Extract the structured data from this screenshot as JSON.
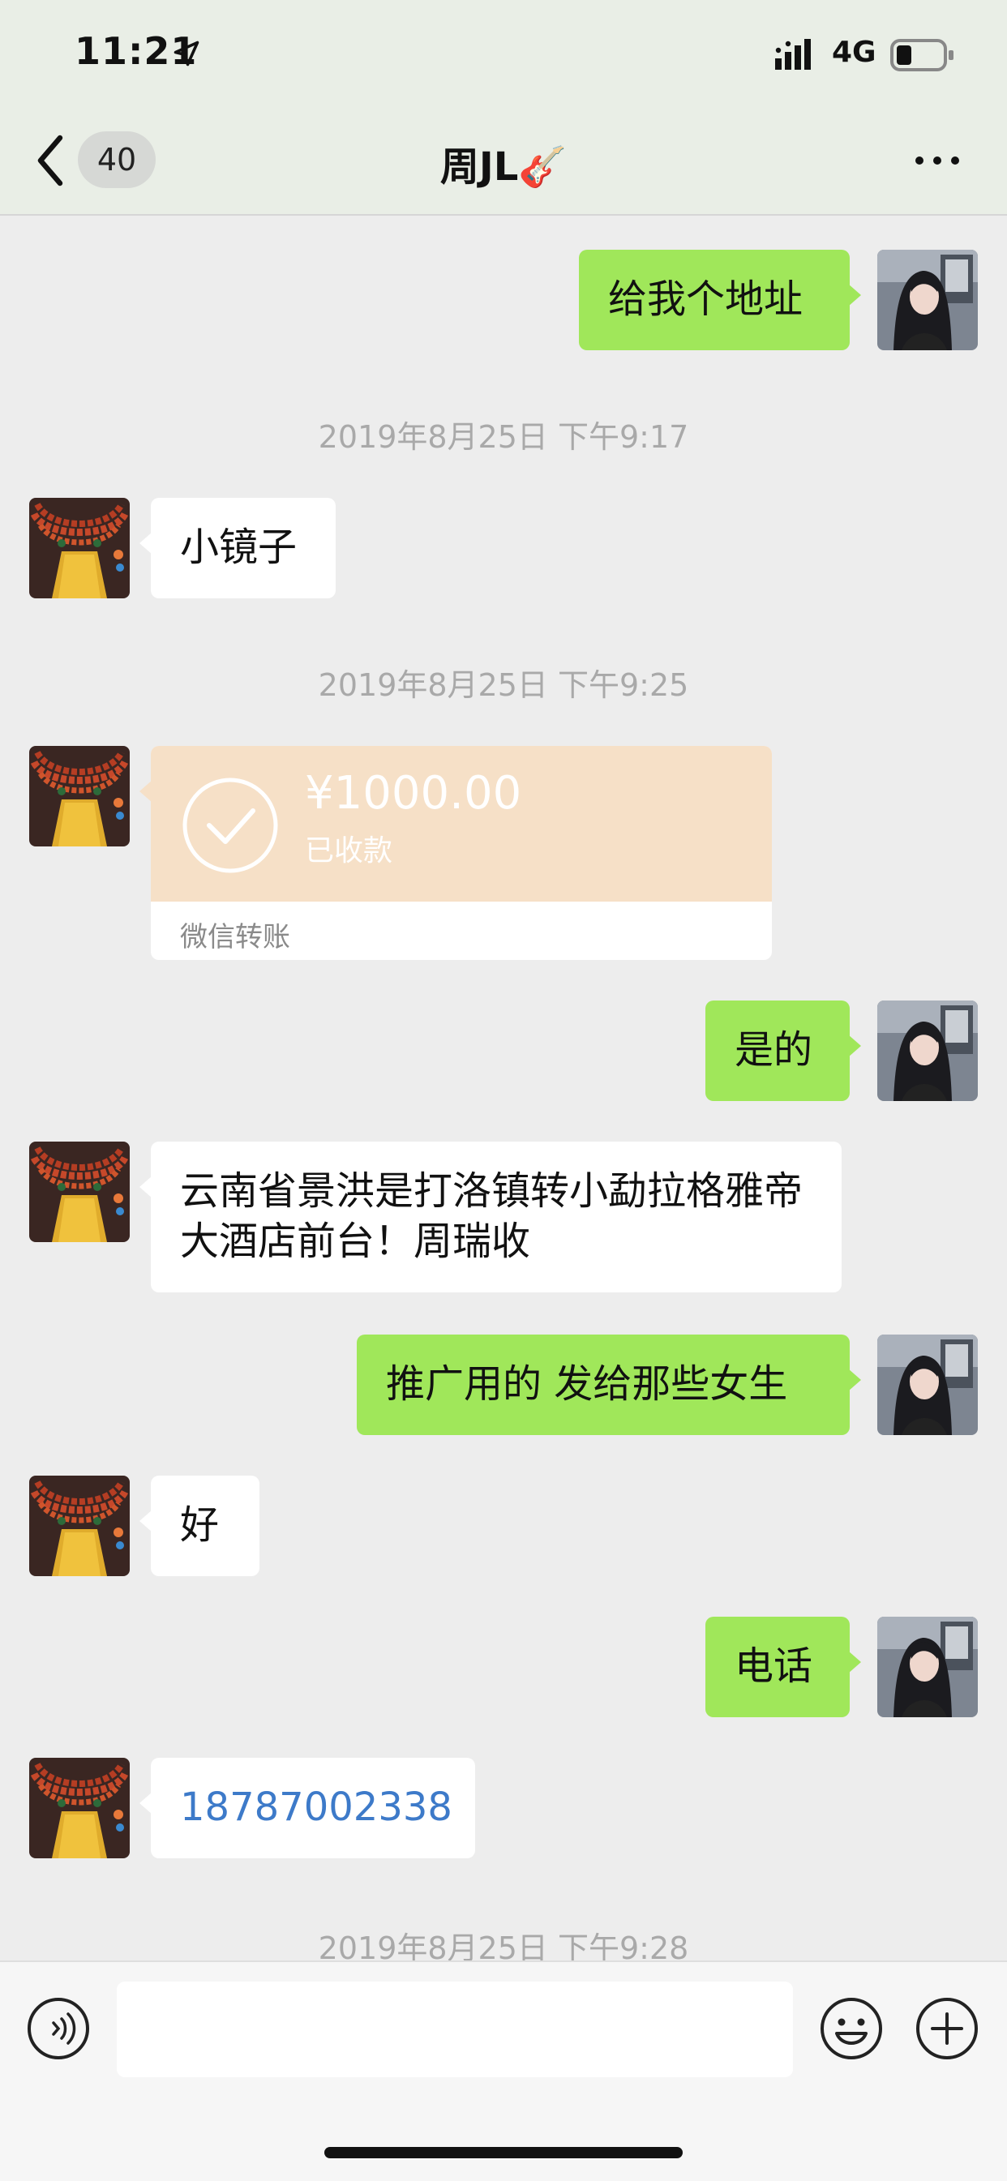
{
  "status_bar": {
    "time": "11:21",
    "network": "4G"
  },
  "nav": {
    "badge_count": "40",
    "title": "周JL🎸"
  },
  "messages": {
    "m1": "给我个地址",
    "ts1": "2019年8月25日 下午9:17",
    "m2": "小镜子",
    "ts2": "2019年8月25日 下午9:25",
    "transfer": {
      "amount": "¥1000.00",
      "status": "已收款",
      "label": "微信转账"
    },
    "m3": "是的",
    "m4": "云南省景洪是打洛镇转小勐拉格雅帝大酒店前台！周瑞收",
    "m5": "推广用的 发给那些女生",
    "m6": "好",
    "m7": "电话",
    "m8": "18787002338",
    "ts3": "2019年8月25日 下午9:28"
  },
  "colors": {
    "outgoing_bubble": "#a0e75a",
    "incoming_bubble": "#ffffff",
    "transfer_card": "#f6e0c7",
    "link": "#3d7ac9",
    "background": "#ededed"
  },
  "input": {
    "placeholder": ""
  }
}
